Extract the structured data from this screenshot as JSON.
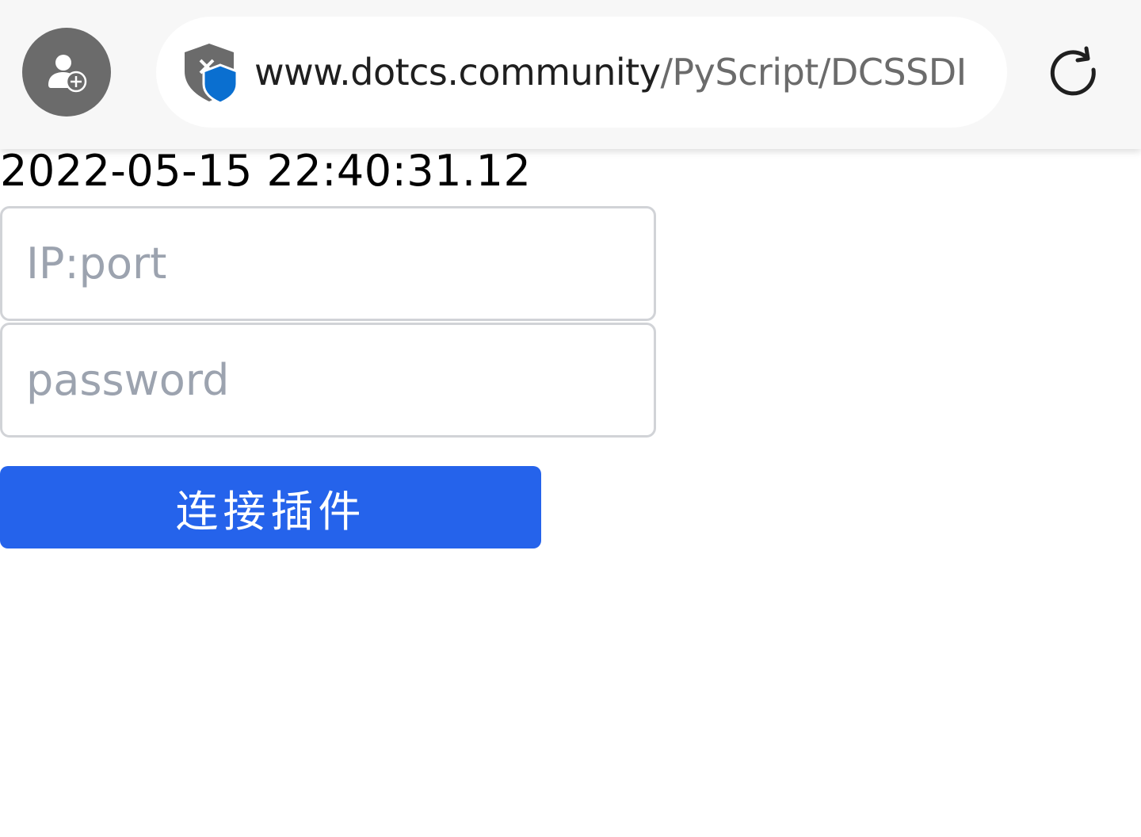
{
  "browser": {
    "url_host": "www.dotcs.community",
    "url_path": "/PyScript/DCSSDI",
    "icons": {
      "profile": "add-user-icon",
      "security": "shield-blocked-icon",
      "reload": "reload-icon"
    }
  },
  "page": {
    "timestamp": "2022-05-15 22:40:31.12",
    "ip_port_placeholder": "IP:port",
    "password_placeholder": "password",
    "connect_label": "连接插件"
  },
  "colors": {
    "accent": "#2563eb",
    "placeholder": "#9ca3af",
    "field_border": "#d1d3d7",
    "browser_bar": "#f7f7f7"
  }
}
